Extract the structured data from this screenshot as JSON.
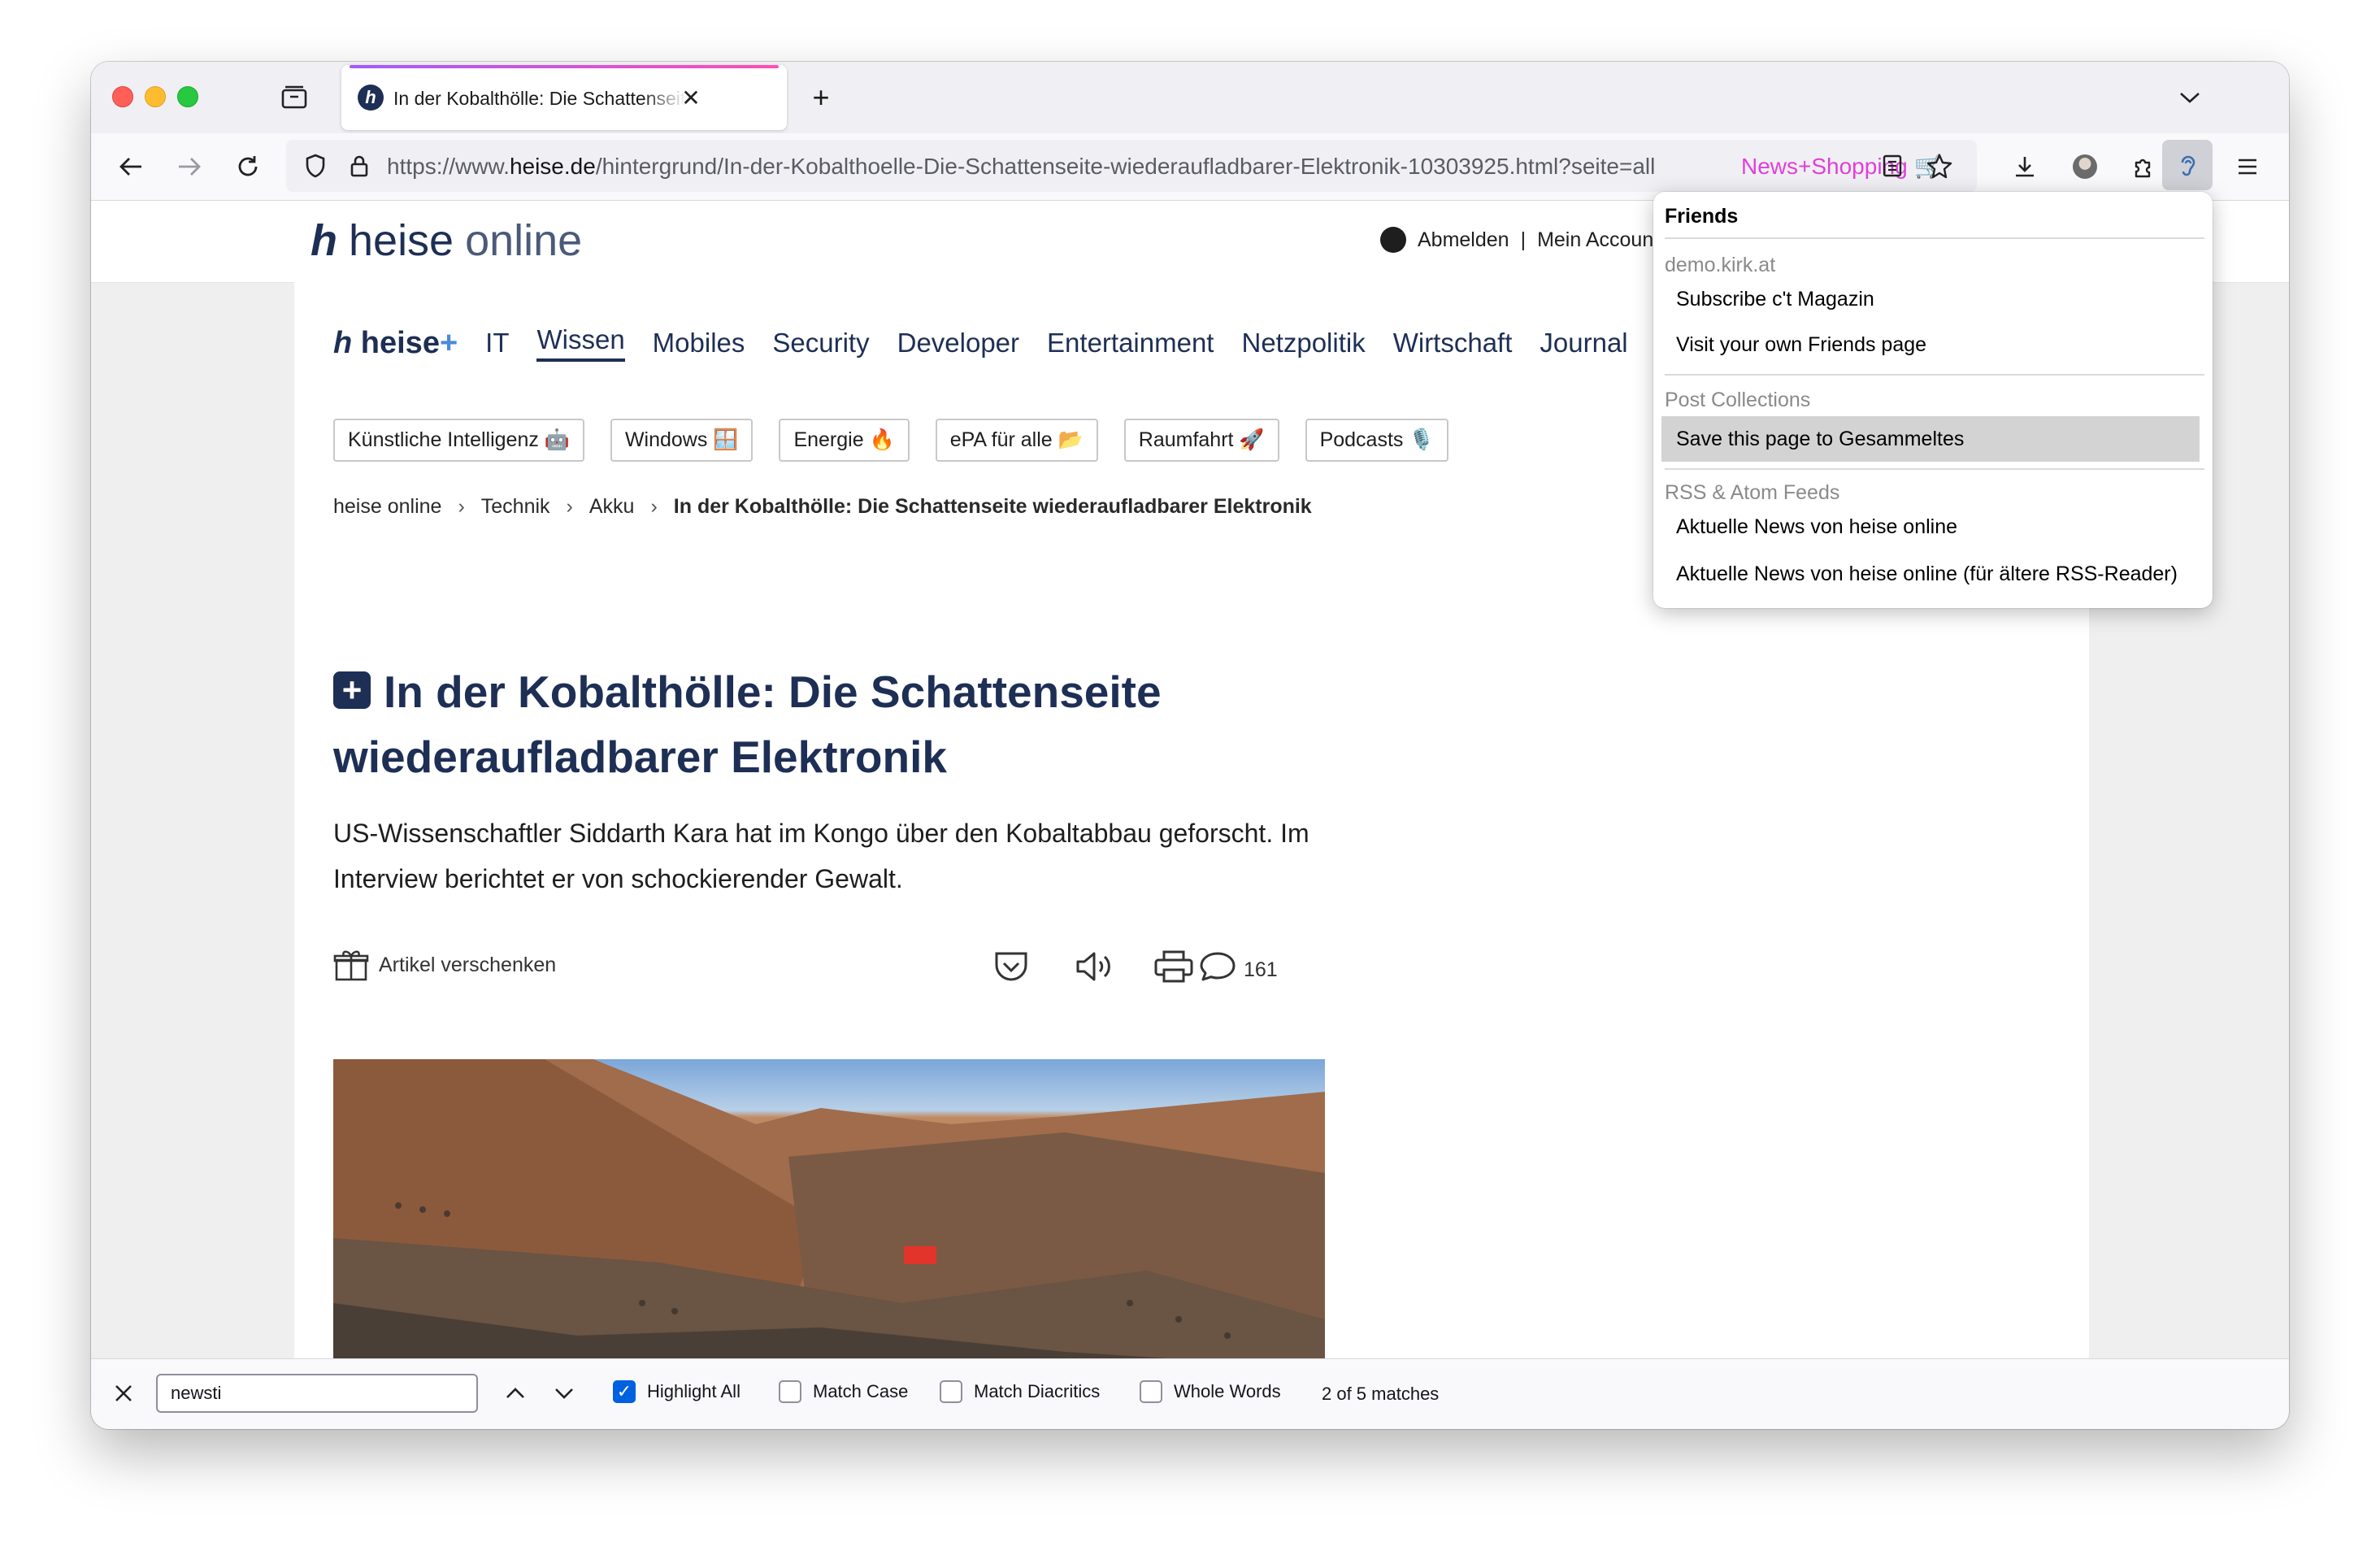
{
  "window": {
    "tab": {
      "title": "In der Kobalthölle: Die Schattenseite wiederaufladbarer Elektronik",
      "favicon_text": "h"
    },
    "url": {
      "prefix": "https://www.",
      "domain": "heise.de",
      "path": "/hintergrund/In-der-Kobalthoelle-Die-Schattenseite-wiederaufladbarer-Elektronik-10303925.html?seite=all"
    },
    "addon_label": "News+Shopping",
    "addon_cart_icon": "🛒"
  },
  "site": {
    "logo_mark": "h",
    "logo_name": "heise",
    "logo_suffix": "online",
    "account": {
      "logout": "Abmelden",
      "separator": "|",
      "my_account": "Mein Account"
    },
    "nav": {
      "plus_label": "heise",
      "plus_sign": "+",
      "items": [
        "IT",
        "Wissen",
        "Mobiles",
        "Security",
        "Developer",
        "Entertainment",
        "Netzpolitik",
        "Wirtschaft",
        "Journal"
      ]
    },
    "chips": [
      "Künstliche Intelligenz 🤖",
      "Windows 🪟",
      "Energie 🔥",
      "ePA für alle 📂",
      "Raumfahrt 🚀",
      "Podcasts 🎙️"
    ],
    "breadcrumb": {
      "items": [
        "heise online",
        "Technik",
        "Akku"
      ],
      "separator": "›",
      "current": "In der Kobalthölle: Die Schattenseite wiederaufladbarer Elektronik"
    },
    "article": {
      "badge": "+",
      "headline": "In der Kobalthölle: Die Schattenseite wiederaufladbarer Elektronik",
      "lead": "US-Wissenschaftler Siddarth Kara hat im Kongo über den Kobaltabbau geforscht. Im Interview berichtet er von schockierender Gewalt.",
      "gift_label": "Artikel verschenken",
      "comment_count": "161"
    }
  },
  "popup": {
    "title": "Friends",
    "account": "demo.kirk.at",
    "items_top": [
      "Subscribe c't Magazin",
      "Visit your own Friends page"
    ],
    "collections_header": "Post Collections",
    "collections_item": "Save this page to Gesammeltes",
    "feeds_header": "RSS & Atom Feeds",
    "feeds": [
      "Aktuelle News von heise online",
      "Aktuelle News von heise online (für ältere RSS-Reader)"
    ]
  },
  "findbar": {
    "query": "newsti",
    "options": [
      {
        "label": "Highlight All",
        "checked": true
      },
      {
        "label": "Match Case",
        "checked": false
      },
      {
        "label": "Match Diacritics",
        "checked": false
      },
      {
        "label": "Whole Words",
        "checked": false
      }
    ],
    "status": "2 of 5 matches"
  },
  "colors": {
    "brand_navy": "#1e2f55",
    "addon_pink": "#e13fd8",
    "checkbox_blue": "#0061e0"
  }
}
